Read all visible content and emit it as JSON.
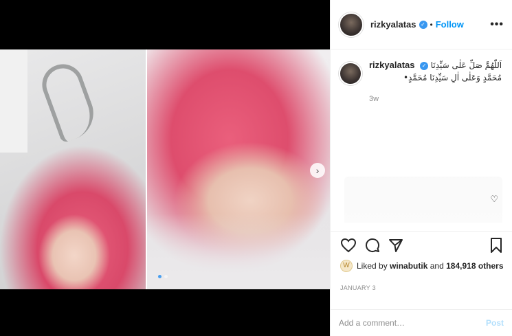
{
  "header": {
    "username": "rizkyalatas",
    "separator": "•",
    "follow_label": "Follow",
    "more_label": "•••"
  },
  "caption": {
    "username": "rizkyalatas",
    "text_line1": "اَللّٰهُمَّ صَلِّ عَلٰى سَيِّدِنَا",
    "text_line2": "مُحَمَّدٍ وَعَلٰى اٰلِ سَيِّدِنَا مُحَمَّدٍ•",
    "age": "3w"
  },
  "media": {
    "next_icon": "chevron-right-icon",
    "dot_count": 2,
    "active_dot": 0
  },
  "actions": {
    "icons": [
      "heart-icon",
      "comment-icon",
      "share-icon",
      "bookmark-icon"
    ]
  },
  "likes": {
    "prefix": "Liked by",
    "user": "winabutik",
    "middle": "and",
    "count": "184,918 others"
  },
  "date": "JANUARY 3",
  "comment": {
    "placeholder": "Add a comment…",
    "post_label": "Post"
  },
  "colors": {
    "link_blue": "#0095f6",
    "post_disabled": "#b2dffc",
    "accent_pink": "#de4d6d"
  }
}
